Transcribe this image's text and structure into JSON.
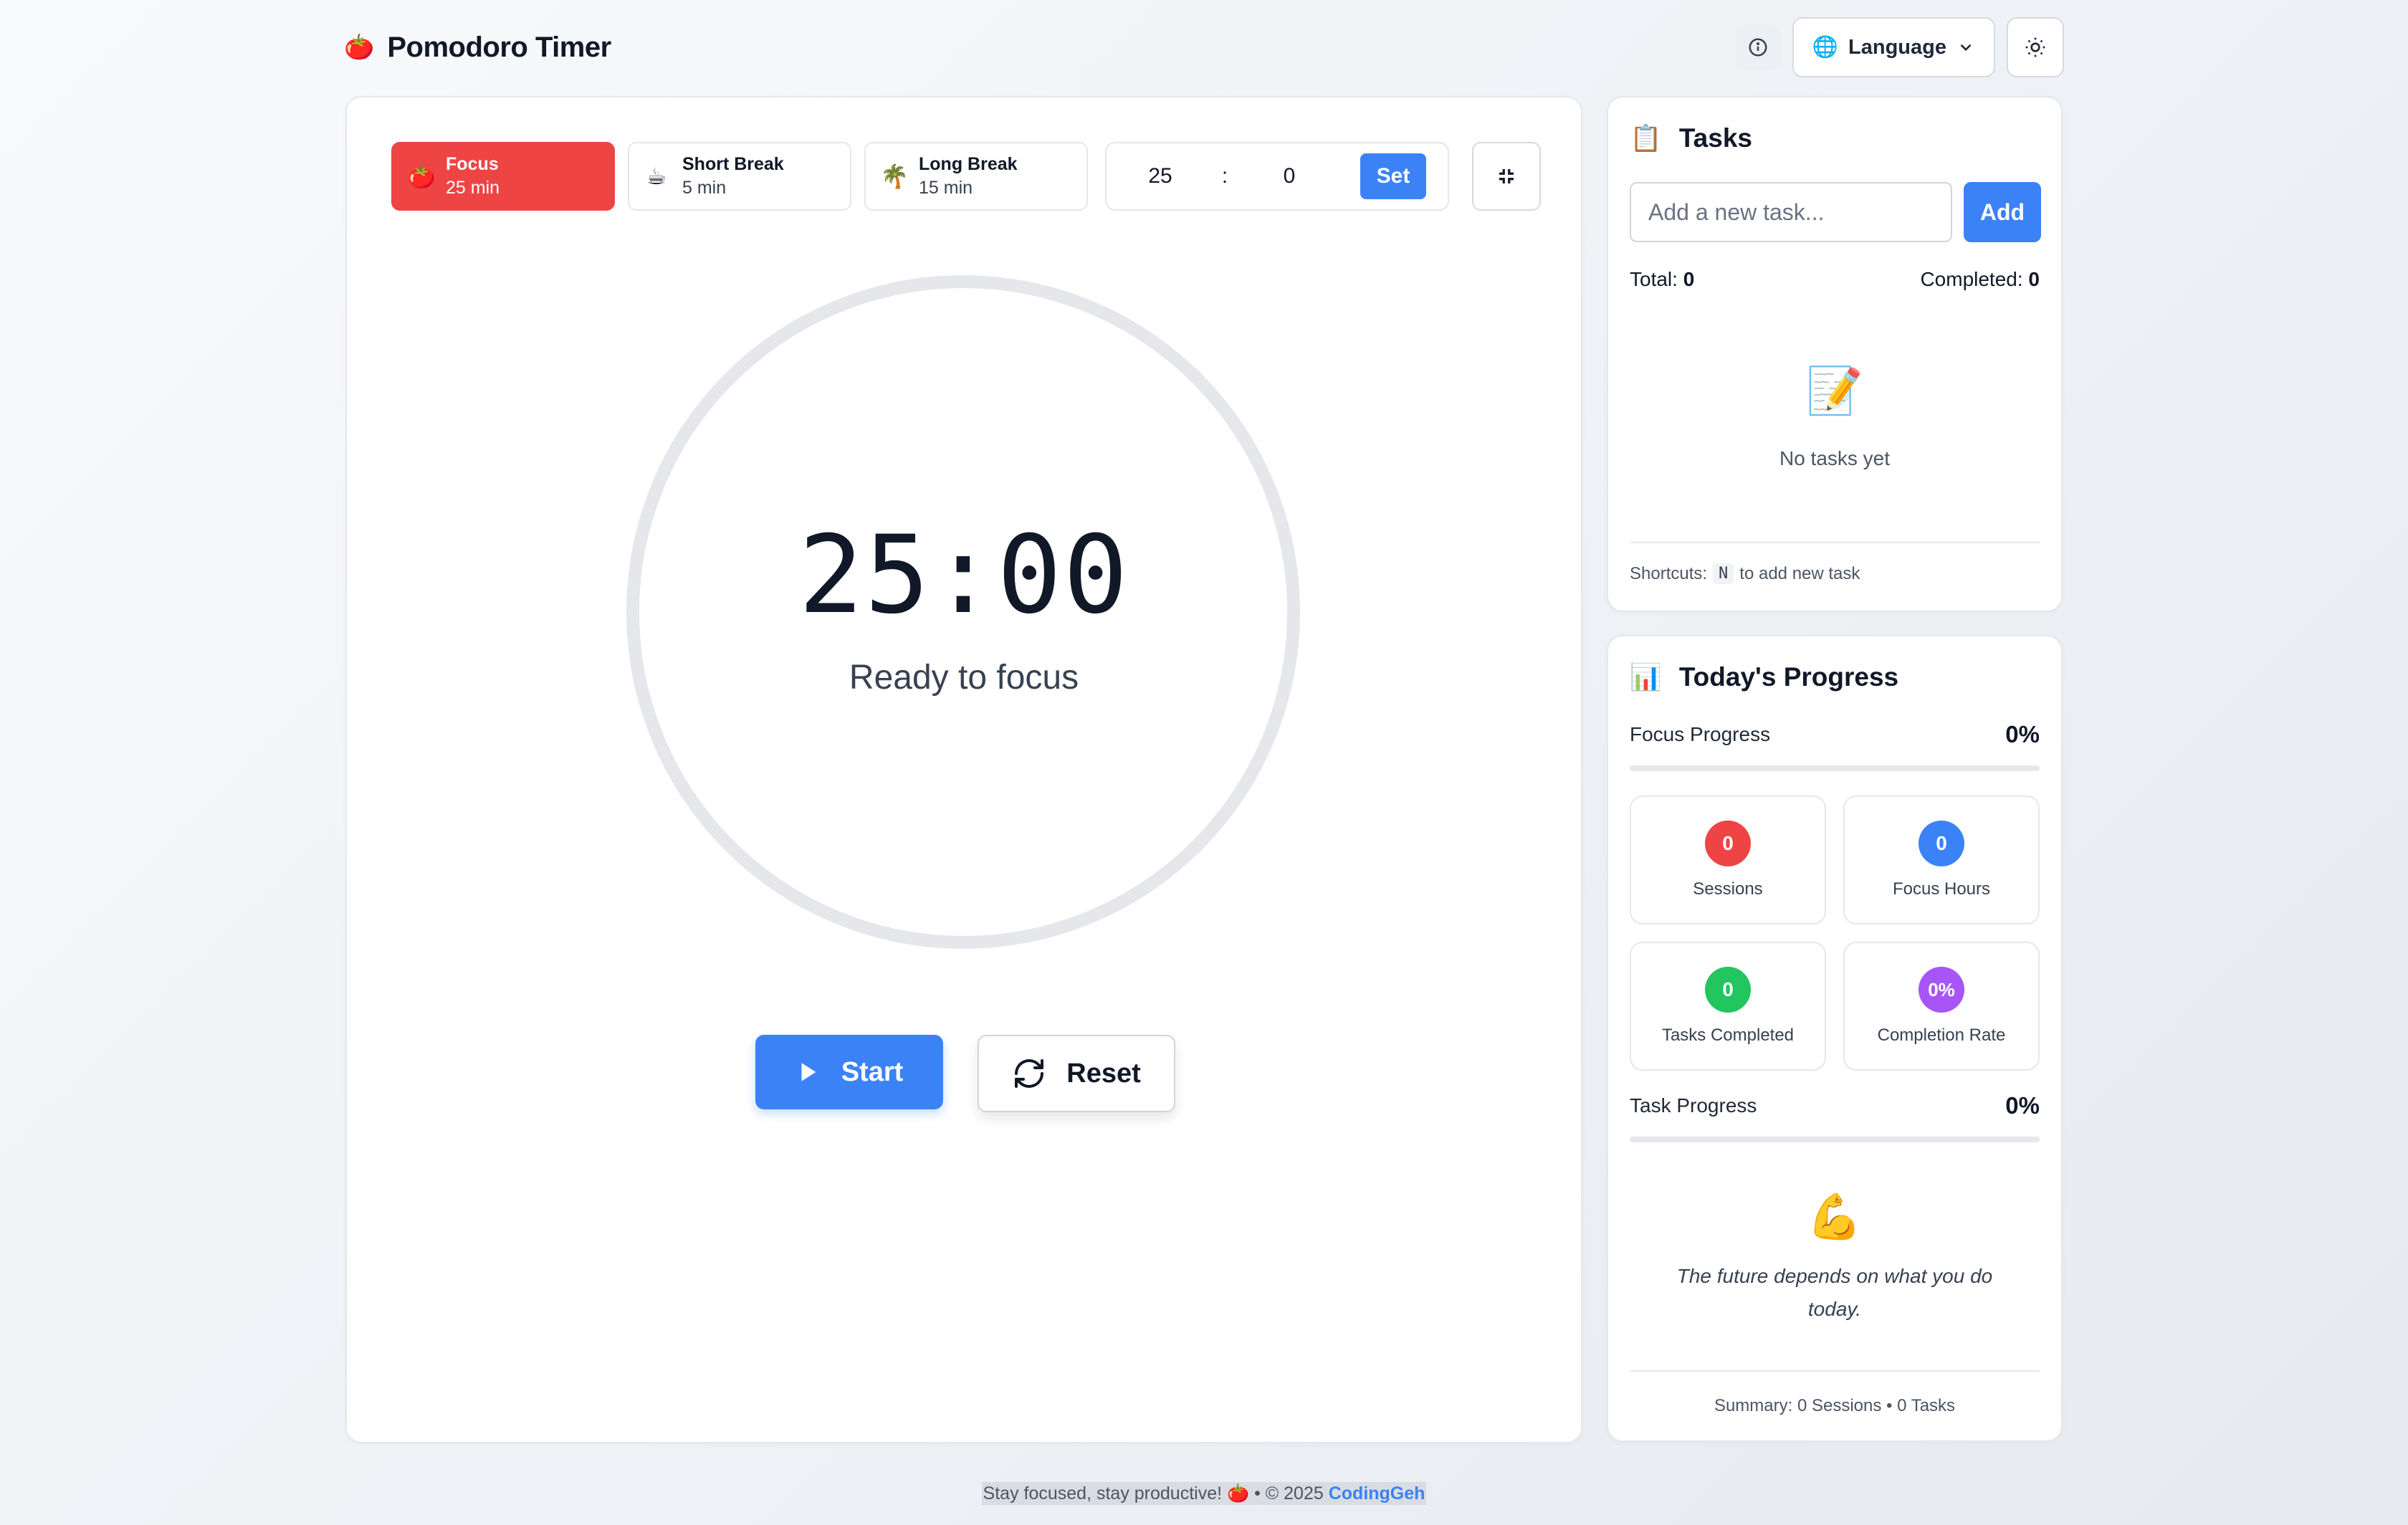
{
  "app": {
    "title": "Pomodoro Timer",
    "logo_icon": "🍅"
  },
  "header": {
    "info_icon": "info-icon",
    "language_label": "Language",
    "language_icon": "🌐",
    "theme_icon": "sun-icon"
  },
  "timer": {
    "modes": [
      {
        "label": "Focus",
        "duration": "25 min",
        "icon": "🍅",
        "active": true
      },
      {
        "label": "Short Break",
        "duration": "5 min",
        "icon": "☕",
        "active": false
      },
      {
        "label": "Long Break",
        "duration": "15 min",
        "icon": "🌴",
        "active": false
      }
    ],
    "custom_minutes": "25",
    "custom_separator": ":",
    "custom_seconds": "0",
    "set_label": "Set",
    "time": "25:00",
    "status": "Ready to focus",
    "start_label": "Start",
    "reset_label": "Reset"
  },
  "tasks": {
    "title": "Tasks",
    "icon": "📋",
    "input_placeholder": "Add a new task...",
    "add_label": "Add",
    "total_label": "Total:",
    "total_value": "0",
    "completed_label": "Completed:",
    "completed_value": "0",
    "empty_icon": "📝",
    "empty_text": "No tasks yet",
    "shortcuts_prefix": "Shortcuts:",
    "shortcut_key": "N",
    "shortcuts_suffix": "to add new task"
  },
  "progress": {
    "title": "Today's Progress",
    "icon": "📊",
    "focus_label": "Focus Progress",
    "focus_pct": "0%",
    "focus_fraction": 0,
    "stats": [
      {
        "value": "0",
        "label": "Sessions",
        "color": "#ef4444"
      },
      {
        "value": "0",
        "label": "Focus Hours",
        "color": "#3b82f6"
      },
      {
        "value": "0",
        "label": "Tasks Completed",
        "color": "#22c55e"
      },
      {
        "value": "0%",
        "label": "Completion Rate",
        "color": "#a855f7"
      }
    ],
    "task_label": "Task Progress",
    "task_pct": "0%",
    "task_fraction": 0,
    "motivation_icon": "💪",
    "quote": "The future depends on what you do today.",
    "summary": "Summary: 0 Sessions • 0 Tasks"
  },
  "footer": {
    "text": "Stay focused, stay productive! 🍅 • © 2025",
    "link": "CodingGeh"
  },
  "colors": {
    "accent": "#3b82f6",
    "focus_red": "#ef4444"
  }
}
